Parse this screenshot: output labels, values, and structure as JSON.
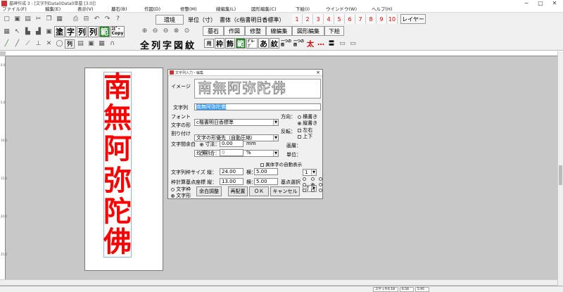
{
  "window": {
    "title": "墓碑作成 3 - [文字列Data0Data0単墓 [3.0]]"
  },
  "window_controls": {
    "minimize": "─",
    "maximize": "□",
    "close": "✕"
  },
  "menu": [
    "ファイル(F)",
    "編集(E)",
    "表示(V)",
    "墓石(B)",
    "作図(D)",
    "修整(M)",
    "線編集(L)",
    "図形編集(C)",
    "下絵(I)",
    "ウインドウ(W)",
    "ヘルプ(H)"
  ],
  "toolbar": {
    "kanji_buttons": [
      "塗",
      "字",
      "列",
      "列",
      "範"
    ],
    "copy_button": "ｽﾋﾟｰ\nCopy",
    "env_button": "環境",
    "unit_label": "単位（寸）",
    "font_label": "書体（c楷書明日香標準）",
    "zoom_icons": [
      "zoom-in",
      "zoom-out-1",
      "zoom-out-2",
      "zoom-fit",
      "zoom-reset"
    ],
    "help_icon": "?",
    "tabs": [
      "墓石",
      "作図",
      "修整",
      "線編集",
      "図形編集",
      "下絵"
    ],
    "numbers": [
      "1",
      "2",
      "3",
      "4",
      "5",
      "6",
      "7",
      "8",
      "9",
      "10"
    ],
    "layer_button": "レイヤー",
    "big_buttons": [
      "全",
      "列",
      "字",
      "図",
      "紋"
    ],
    "row3_small": [
      "用",
      "枠",
      "飾",
      "範",
      "ｸﾞﾙｰﾌﾟ",
      "あ",
      "紋",
      "一つの\n面",
      "一つの\n面",
      "太",
      "…",
      "〓",
      "〓"
    ],
    "row2_small": [
      "列",
      "ｸﾞ"
    ]
  },
  "ruler": {
    "left_labels": [
      "0.0",
      "5.0",
      "10.0",
      "15.0",
      "20.0",
      "25.0"
    ]
  },
  "canvas": {
    "characters": [
      "南",
      "無",
      "阿",
      "弥",
      "陀",
      "佛"
    ],
    "char_color": "#ff0000"
  },
  "dialog": {
    "title": "文字列入力・編集",
    "close": "×",
    "image_label": "イメージ",
    "preview_text": "南無阿弥陀佛",
    "text_label": "文字列",
    "text_value": "南無阿弥陀佛",
    "font_label": "フォント",
    "font_value": "c楷書明日香標準",
    "shape_label": "文字の形",
    "shape_value": "文字の形優先（自動圧縮）",
    "split_label": "割り付け",
    "split_value": "均等",
    "spacing_label": "文字間余白",
    "spacing_mode_dim": "寸法：",
    "spacing_dim_value": "0.00",
    "spacing_dim_unit": "mm",
    "spacing_mode_ratio": "割合：",
    "spacing_ratio_value": "0",
    "spacing_ratio_unit": "%",
    "direction_label": "方向：",
    "direction_horizontal": "横書き",
    "direction_vertical": "縦書き",
    "flip_label": "反転：",
    "flip_lr": "左右",
    "flip_ud": "上下",
    "layer_label": "画層：",
    "layer_value": "1",
    "unit_label": "単位：",
    "unit_value": "寸",
    "auto_display_label": "異体字の自動表示",
    "frame_size_label": "文字列枠サイズ 縦：",
    "frame_h": "24.00",
    "frame_w_label": "横：",
    "frame_w": "5.00",
    "base_label": "枠計算基点座標 縦：",
    "base_h": "13.00",
    "base_w_label": "横：",
    "base_w": "5.00",
    "base_select_label": "基点選択",
    "radio_frame": "文字枠",
    "radio_shape": "文字形",
    "margin_button": "余白調整",
    "relayout_button": "再配置",
    "ok_button": "ＯＫ",
    "cancel_button": "キャンセル"
  },
  "status": {
    "label": "スケッチ6.18",
    "x": "6.56",
    "y": "5.95"
  }
}
